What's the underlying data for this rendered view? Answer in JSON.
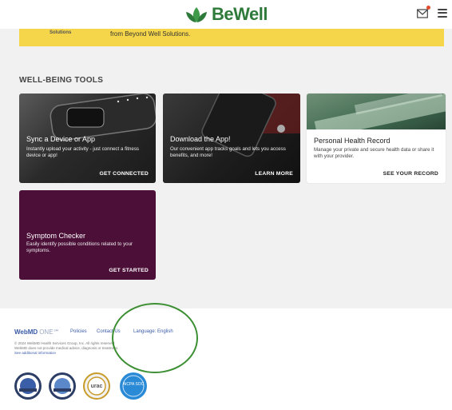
{
  "header": {
    "brand": "BeWell",
    "brand_color": "#2e7a3a",
    "icons": [
      "mail-icon",
      "hamburger-menu-icon"
    ]
  },
  "banner": {
    "label": "Solutions",
    "text": "from Beyond Well Solutions."
  },
  "section": {
    "title": "WELL-BEING TOOLS"
  },
  "cards": [
    {
      "title": "Sync a Device or App",
      "desc": "Instantly upload your activity - just connect a fitness device or app!",
      "cta": "GET CONNECTED"
    },
    {
      "title": "Download the App!",
      "desc": "Our convenient app tracks goals and lets you access benefits, and more!",
      "cta": "LEARN MORE"
    },
    {
      "title": "Personal Health Record",
      "desc": "Manage your private and secure health data or share it with your provider.",
      "cta": "SEE YOUR RECORD"
    },
    {
      "title": "Symptom Checker",
      "desc": "Easily identify possible conditions related to your symptoms.",
      "cta": "GET STARTED"
    }
  ],
  "footer": {
    "brand_main": "WebMD",
    "brand_sub": "ONE℠",
    "links": [
      "Policies",
      "Contact Us",
      "Language: English"
    ],
    "line1": "© 2024 WebMD Health Services Group, Inc. All rights reserved.",
    "line2": "WebMD does not provide medical advice, diagnosis or treatment.",
    "line3": "See additional information",
    "badges": [
      "accreditation-seal-icon",
      "accreditation-seal-icon",
      "urac-seal-icon",
      "aicpa-soc-seal-icon"
    ]
  },
  "badges": {
    "urac": "urac",
    "aicpa": "AICPA SOC"
  },
  "colors": {
    "banner": "#f5d64a",
    "card_purple": "#4b0f38",
    "link": "#3a5aa7",
    "highlight_circle": "#3d8f34"
  }
}
